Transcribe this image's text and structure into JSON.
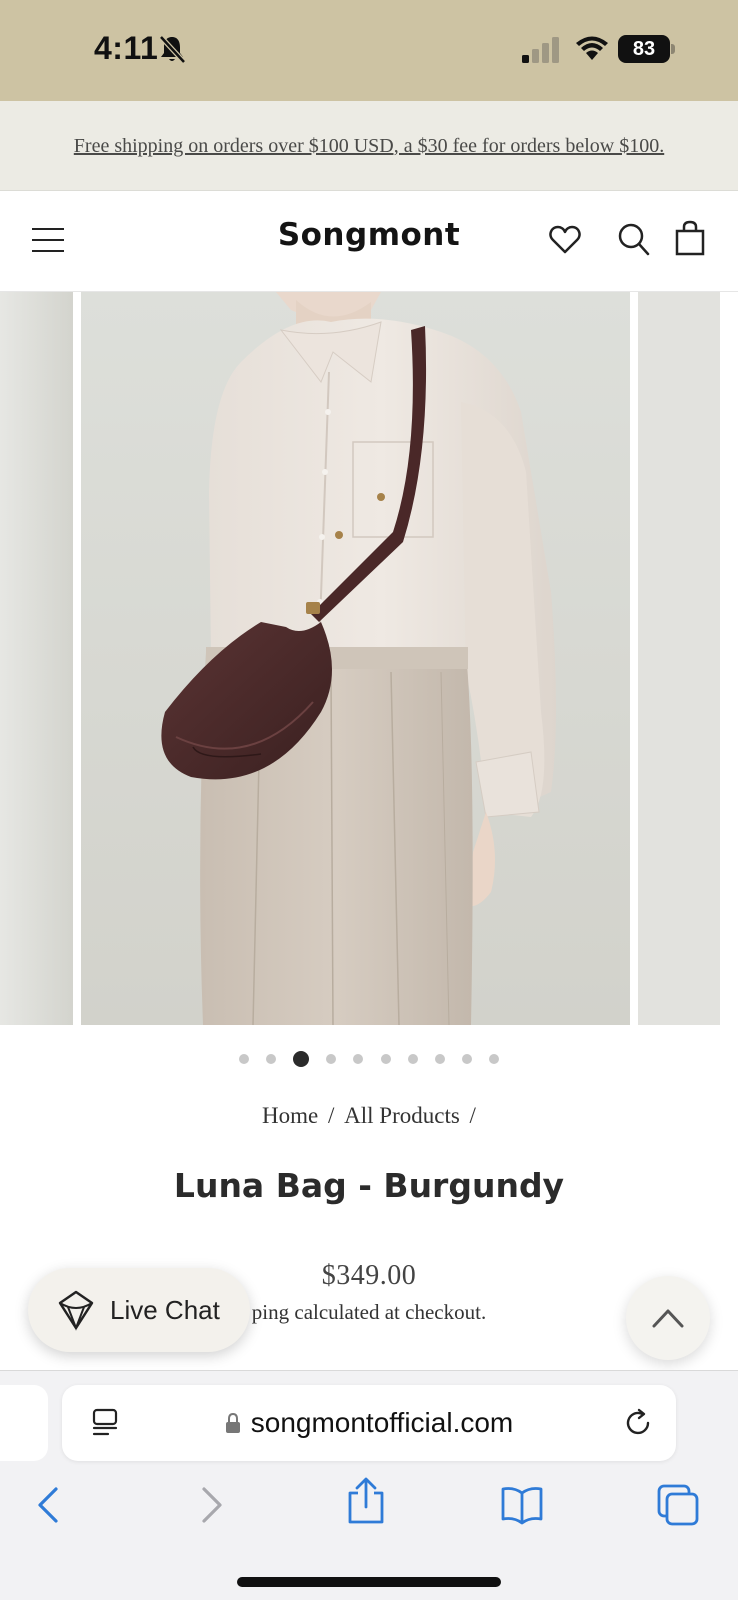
{
  "status_bar": {
    "time": "4:11",
    "battery": "83",
    "bell_icon": "bell-slash-icon",
    "signal_icon": "cellular-signal-icon",
    "wifi_icon": "wifi-icon"
  },
  "announcement": {
    "text": "Free shipping on orders over $100 USD, a $30 fee for orders below $100."
  },
  "header": {
    "brand": "Songmont",
    "icons": [
      "menu-icon",
      "heart-icon",
      "search-icon",
      "shopping-bag-icon"
    ]
  },
  "gallery": {
    "dot_count": 10,
    "active_index": 2,
    "zoom_icon": "zoom-icon"
  },
  "product": {
    "breadcrumb": [
      "Home",
      "/",
      "All Products",
      "/"
    ],
    "title": "Luna Bag - Burgundy",
    "price": "$349.00",
    "shipping_note": "ping calculated at checkout."
  },
  "live_chat": {
    "label": "Live Chat"
  },
  "browser": {
    "url": "songmontofficial.com"
  },
  "colors": {
    "status_bar": "#cdc3a3",
    "announcement_bg": "#ecebe4",
    "bag_burgundy": "#4a2a2a",
    "browser_accent": "#2f7bd7"
  }
}
